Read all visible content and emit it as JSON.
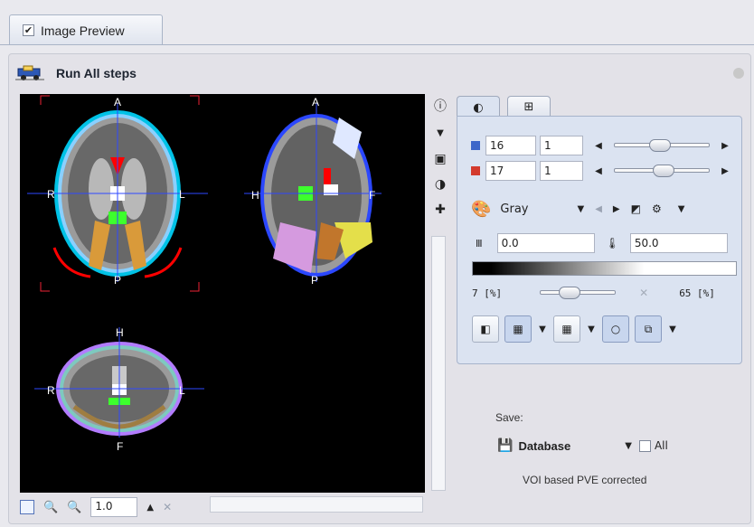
{
  "tab": {
    "label": "Image Preview",
    "checked": "✔"
  },
  "run": {
    "label": "Run All steps"
  },
  "viewer": {
    "labels": {
      "axial_top": "A",
      "axial_left": "R",
      "axial_right": "L",
      "axial_bottom": "P",
      "sag_top": "A",
      "sag_left": "H",
      "sag_right": "F",
      "sag_bottom": "P",
      "cor_top": "H",
      "cor_left": "R",
      "cor_right": "L",
      "cor_bottom": "F"
    },
    "zoom_value": "1.0"
  },
  "controls": {
    "row1": {
      "value": "16",
      "step": "1"
    },
    "row2": {
      "value": "17",
      "step": "1"
    },
    "colormap": "Gray",
    "range_min": "0.0",
    "range_max": "50.0",
    "lower_pct": "7 [%]",
    "upper_pct": "65 [%]"
  },
  "save": {
    "label": "Save:",
    "target": "Database",
    "all_label": "All"
  },
  "status": "VOI based PVE corrected",
  "sliders": {
    "row1_fraction": 0.48,
    "row2_fraction": 0.52,
    "threshold_fraction": 0.35
  }
}
